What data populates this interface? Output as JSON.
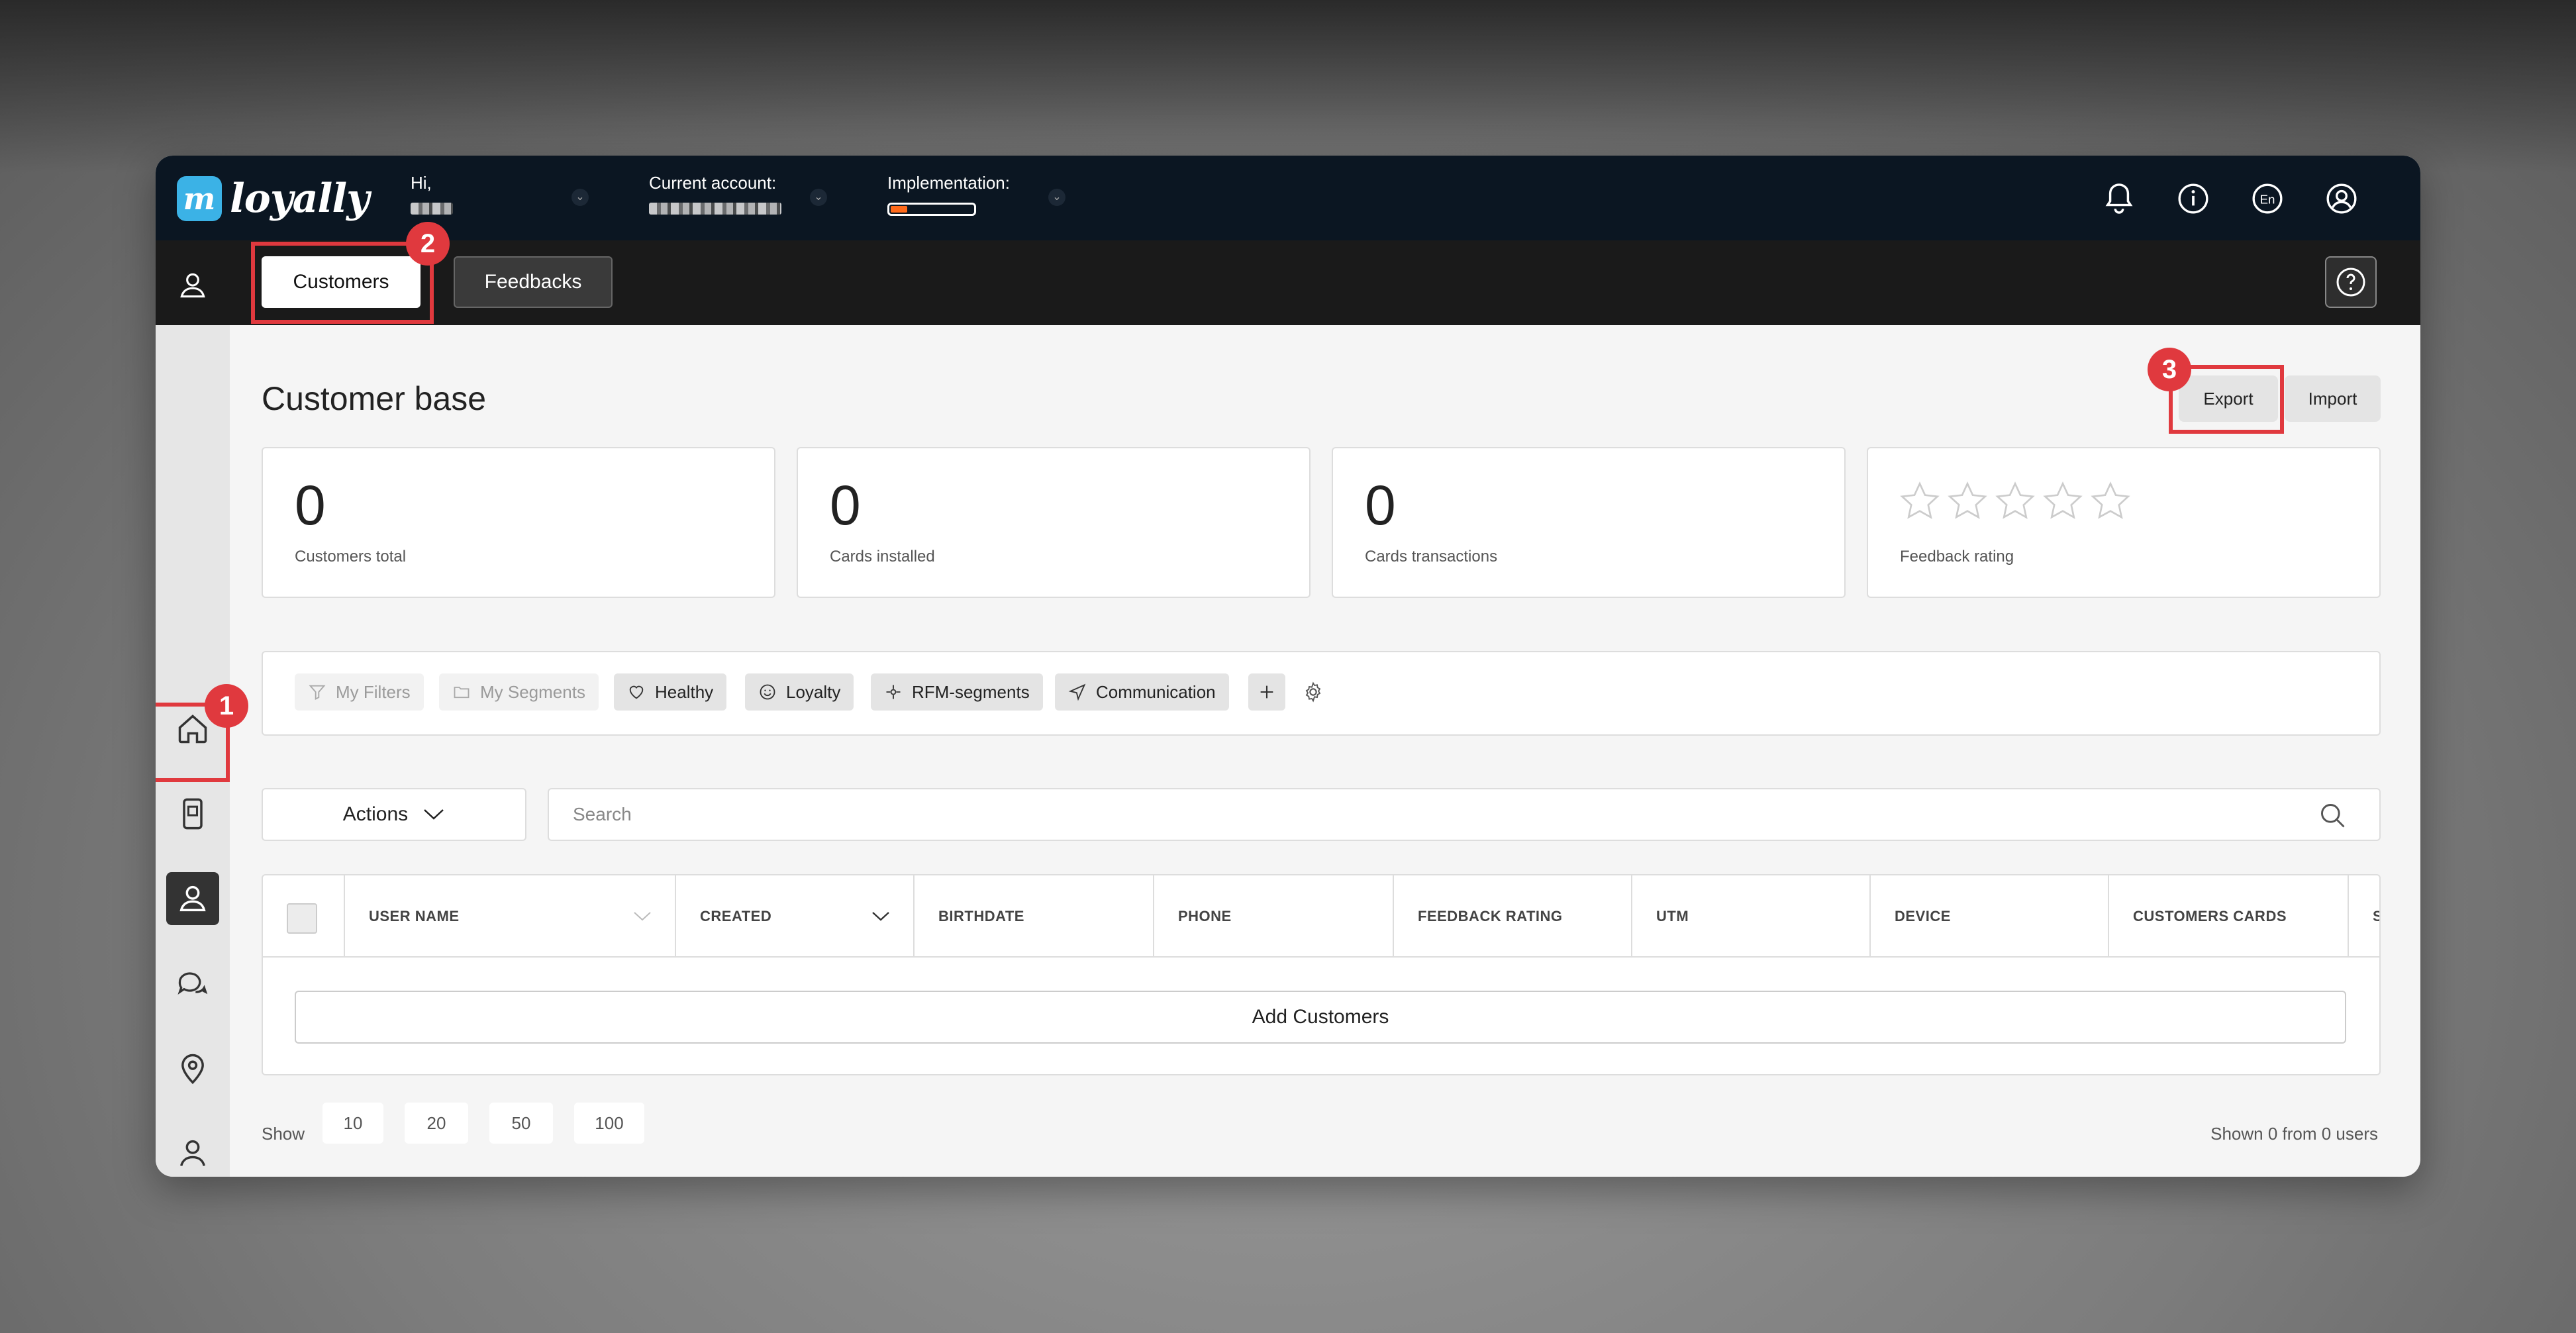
{
  "header": {
    "logo_text": "loyally",
    "greeting_label": "Hi,",
    "account_label": "Current account:",
    "implementation_label": "Implementation:",
    "implementation_progress": 0.2
  },
  "subbar": {
    "tabs": [
      {
        "label": "Customers"
      },
      {
        "label": "Feedbacks"
      }
    ]
  },
  "page": {
    "title": "Customer base",
    "export_label": "Export",
    "import_label": "Import"
  },
  "stats": [
    {
      "value": "0",
      "label": "Customers total"
    },
    {
      "value": "0",
      "label": "Cards installed"
    },
    {
      "value": "0",
      "label": "Cards transactions"
    },
    {
      "label": "Feedback rating",
      "stars": 0
    }
  ],
  "filters": {
    "my_filters": "My Filters",
    "my_segments": "My Segments",
    "tags": [
      "Healthy",
      "Loyalty",
      "RFM-segments",
      "Communication"
    ]
  },
  "toolbar": {
    "actions_label": "Actions",
    "search_placeholder": "Search"
  },
  "table": {
    "columns": [
      "USER NAME",
      "CREATED",
      "BIRTHDATE",
      "PHONE",
      "FEEDBACK RATING",
      "UTM",
      "DEVICE",
      "CUSTOMERS CARDS",
      "S"
    ],
    "add_label": "Add Customers"
  },
  "pagination": {
    "show_label": "Show",
    "sizes": [
      "10",
      "20",
      "50",
      "100"
    ],
    "summary": "Shown 0 from 0 users"
  },
  "annotations": [
    "1",
    "2",
    "3"
  ],
  "colors": {
    "header_bg": "#0b1622",
    "accent_annotation": "#e0393e",
    "logo_blue": "#3bb2e6",
    "progress": "#ff6a1a"
  }
}
